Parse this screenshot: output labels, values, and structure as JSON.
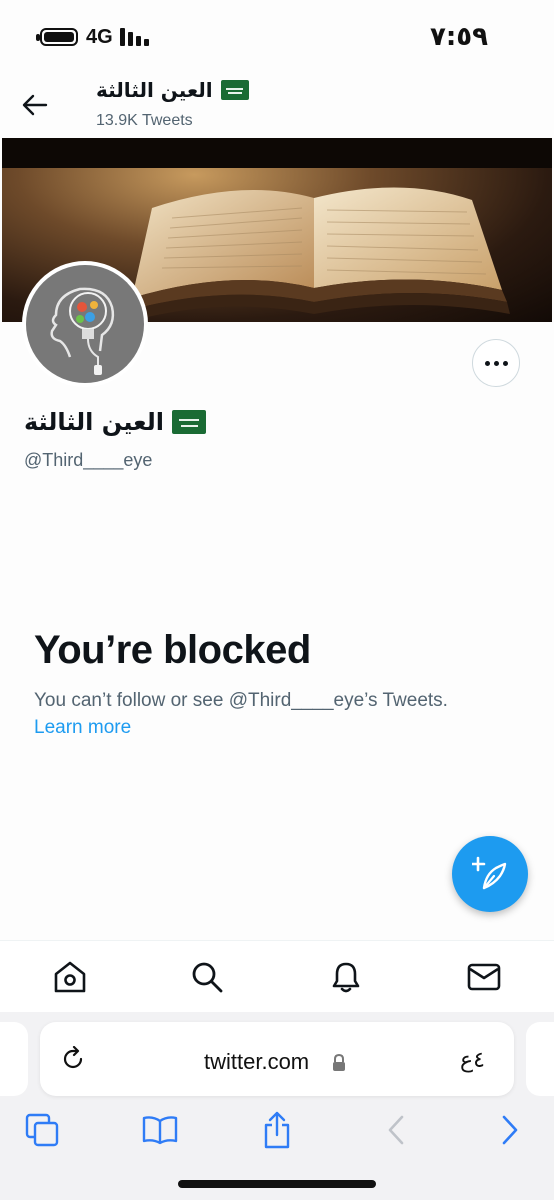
{
  "status_bar": {
    "network": "4G",
    "time": "٧:٥٩"
  },
  "header": {
    "title": "العين الثالثة",
    "tweet_count": "13.9K Tweets"
  },
  "profile": {
    "name": "العين الثالثة",
    "handle": "@Third____eye"
  },
  "blocked": {
    "title": "You’re blocked",
    "description": "You can’t follow or see @Third____eye’s Tweets.",
    "learn_more": "Learn more"
  },
  "browser": {
    "url": "twitter.com",
    "text_size_label": "٤ع"
  },
  "colors": {
    "accent": "#1d9bf0",
    "text_primary": "#0f1419",
    "text_secondary": "#536471",
    "flag_green": "#1a6b34",
    "safari_blue": "#2f7cf6"
  },
  "icons": {
    "back": "arrow-left-icon",
    "more": "more-dots-icon",
    "compose": "compose-tweet-icon",
    "tabs": [
      "home-icon",
      "search-icon",
      "notifications-icon",
      "messages-icon"
    ],
    "safari": [
      "tabs-icon",
      "bookmarks-icon",
      "share-icon",
      "browser-back-icon",
      "browser-forward-icon"
    ]
  }
}
